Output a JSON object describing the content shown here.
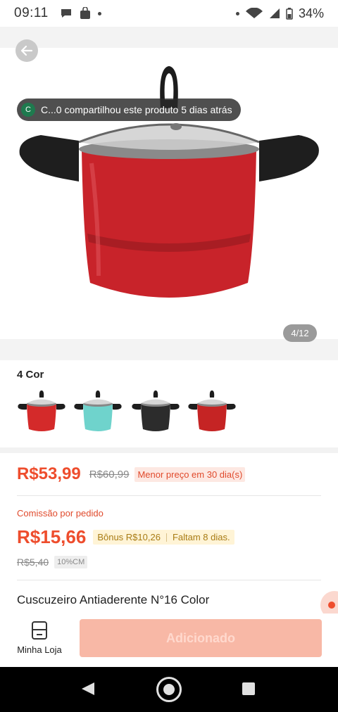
{
  "status_bar": {
    "time": "09:11",
    "battery": "34%"
  },
  "gallery": {
    "share_toast_avatar": "C",
    "share_toast_text": "C...0 compartilhou este produto 5 dias atrás",
    "page_indicator": "4/12"
  },
  "colors_section": {
    "title": "4 Cor",
    "swatches": [
      {
        "color": "#d42a2a"
      },
      {
        "color": "#6fd3cc"
      },
      {
        "color": "#2c2c2c"
      },
      {
        "color": "#c52424"
      }
    ]
  },
  "price": {
    "current": "R$53,99",
    "original": "R$60,99",
    "badge": "Menor preço em 30 dia(s)"
  },
  "commission": {
    "label": "Comissão por pedido",
    "value": "R$15,66",
    "bonus": "Bônus R$10,26",
    "remaining": "Faltam 8 dias.",
    "old_value": "R$5,40",
    "rate_badge": "10%CM"
  },
  "product": {
    "title": "Cuscuzeiro Antiaderente N°16 Color"
  },
  "action_bar": {
    "store_label": "Minha Loja",
    "add_button": "Adicionado"
  },
  "theme": {
    "accent": "#ee4d2d",
    "pot_red": "#c8232a"
  }
}
